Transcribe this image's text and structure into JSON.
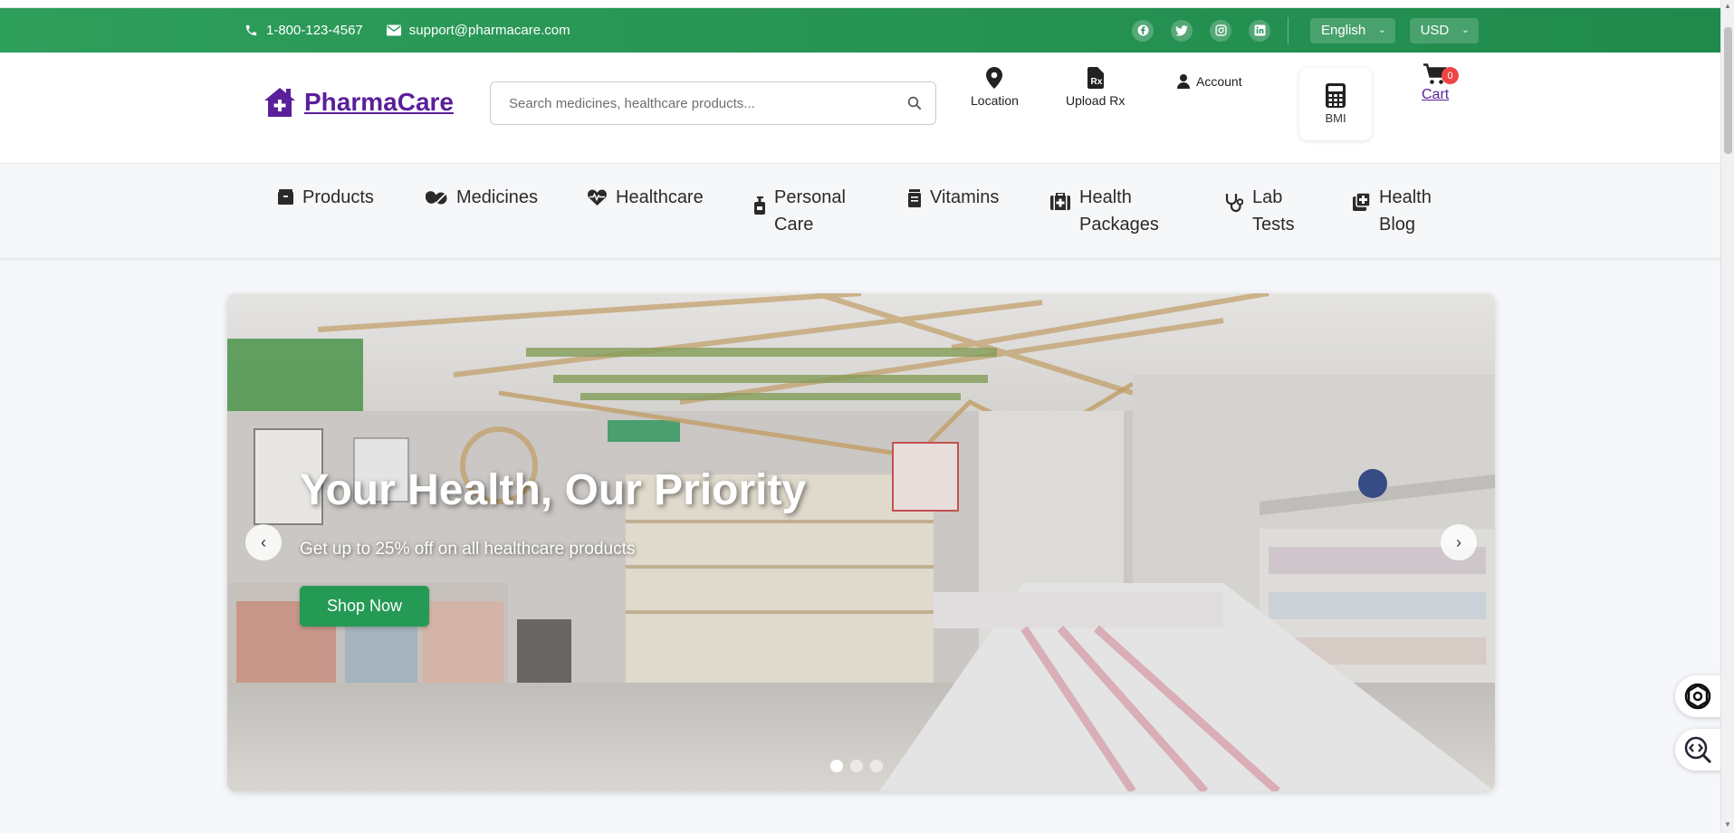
{
  "topbar": {
    "phone": "1-800-123-4567",
    "email": "support@pharmacare.com",
    "socials": [
      "facebook-icon",
      "twitter-icon",
      "instagram-icon",
      "linkedin-icon"
    ],
    "language": "English",
    "currency": "USD"
  },
  "header": {
    "logo_text": "PharmaCare",
    "search_placeholder": "Search medicines, healthcare products...",
    "location_label": "Location",
    "upload_label": "Upload Rx",
    "account_label": "Account",
    "bmi_label": "BMI",
    "cart_label": "Cart",
    "cart_count": "0"
  },
  "nav": {
    "items": [
      {
        "label": "Products",
        "icon": "box-icon"
      },
      {
        "label": "Medicines",
        "icon": "pills-icon"
      },
      {
        "label": "Healthcare",
        "icon": "heart-pulse-icon"
      },
      {
        "label": "Personal Care",
        "icon": "pump-bottle-icon"
      },
      {
        "label": "Vitamins",
        "icon": "supplement-jar-icon"
      },
      {
        "label": "Health Packages",
        "icon": "medical-kit-icon"
      },
      {
        "label": "Lab Tests",
        "icon": "stethoscope-icon"
      },
      {
        "label": "Health Blog",
        "icon": "notes-medical-icon"
      }
    ]
  },
  "hero": {
    "title": "Your Health, Our Priority",
    "subtitle": "Get up to 25% off on all healthcare products",
    "cta": "Shop Now",
    "slides_total": 3,
    "active_slide": 1
  },
  "colors": {
    "brand_green": "#259a55",
    "brand_purple": "#5a1f9a",
    "badge_red": "#f04545"
  }
}
